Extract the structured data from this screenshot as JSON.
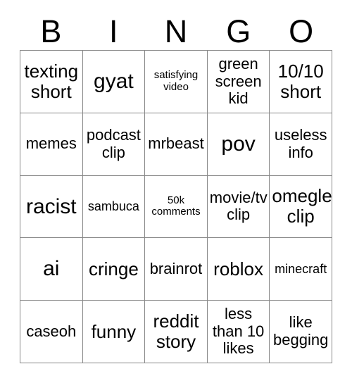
{
  "header": {
    "letters": [
      "B",
      "I",
      "N",
      "G",
      "O"
    ]
  },
  "grid": {
    "rows": 5,
    "columns": 5,
    "border_color": "#888888",
    "background_color": "#ffffff",
    "text_color": "#000000",
    "cells": [
      [
        {
          "text": "texting\nshort",
          "size": "lg"
        },
        {
          "text": "gyat",
          "size": "xl"
        },
        {
          "text": "satisfying\nvideo",
          "size": "xs"
        },
        {
          "text": "green\nscreen\nkid",
          "size": "md"
        },
        {
          "text": "10/10\nshort",
          "size": "lg"
        }
      ],
      [
        {
          "text": "memes",
          "size": "md"
        },
        {
          "text": "podcast\nclip",
          "size": "md"
        },
        {
          "text": "mrbeast",
          "size": "md"
        },
        {
          "text": "pov",
          "size": "xl"
        },
        {
          "text": "useless\ninfo",
          "size": "md"
        }
      ],
      [
        {
          "text": "racist",
          "size": "xl"
        },
        {
          "text": "sambuca",
          "size": "sm"
        },
        {
          "text": "50k\ncomments",
          "size": "xs"
        },
        {
          "text": "movie/tv\nclip",
          "size": "md"
        },
        {
          "text": "omegle\nclip",
          "size": "lg"
        }
      ],
      [
        {
          "text": "ai",
          "size": "xl"
        },
        {
          "text": "cringe",
          "size": "lg"
        },
        {
          "text": "brainrot",
          "size": "md"
        },
        {
          "text": "roblox",
          "size": "lg"
        },
        {
          "text": "minecraft",
          "size": "sm"
        }
      ],
      [
        {
          "text": "caseoh",
          "size": "md"
        },
        {
          "text": "funny",
          "size": "lg"
        },
        {
          "text": "reddit\nstory",
          "size": "lg"
        },
        {
          "text": "less\nthan 10\nlikes",
          "size": "md"
        },
        {
          "text": "like\nbegging",
          "size": "md"
        }
      ]
    ]
  }
}
